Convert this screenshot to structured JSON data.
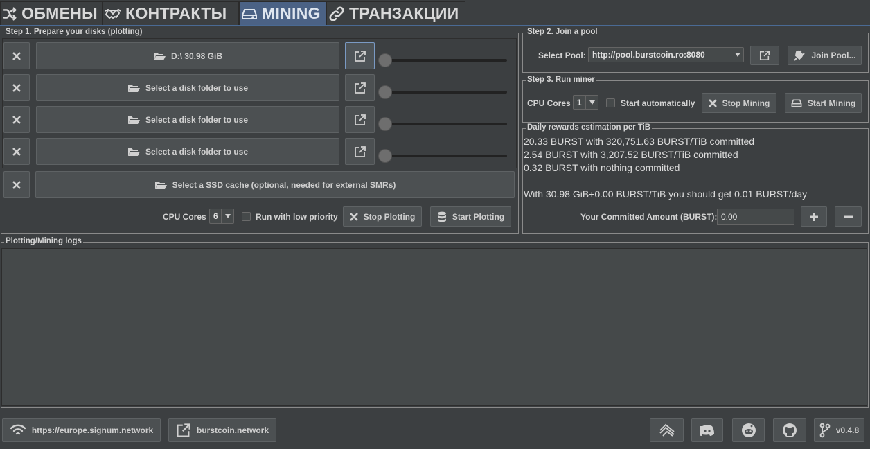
{
  "tabs": [
    {
      "label": "ОБМЕНЫ",
      "icon": "shuffle-icon",
      "active": false
    },
    {
      "label": "КОНТРАКТЫ",
      "icon": "handshake-icon",
      "active": false
    },
    {
      "label": "MINING",
      "icon": "hard-drive-icon",
      "active": true
    },
    {
      "label": "ТРАНЗАКЦИИ",
      "icon": "link-icon",
      "active": false
    }
  ],
  "step1": {
    "title": "Step 1. Prepare your disks (plotting)",
    "disks": [
      {
        "label": "D:\\ 30.98 GiB"
      },
      {
        "label": "Select a disk folder to use"
      },
      {
        "label": "Select a disk folder to use"
      },
      {
        "label": "Select a disk folder to use"
      }
    ],
    "ssd_label": "Select a SSD cache (optional, needed for external SMRs)",
    "cpu_cores_label": "CPU Cores",
    "cpu_cores_value": "6",
    "low_priority_label": "Run with low priority",
    "stop_plotting": "Stop Plotting",
    "start_plotting": "Start Plotting"
  },
  "step2": {
    "title": "Step 2. Join a pool",
    "select_pool_label": "Select Pool:",
    "pool_value": "http://pool.burstcoin.ro:8080",
    "join_pool": "Join Pool..."
  },
  "step3": {
    "title": "Step 3. Run miner",
    "cpu_cores_label": "CPU Cores",
    "cpu_cores_value": "1",
    "start_auto_label": "Start automatically",
    "stop_mining": "Stop Mining",
    "start_mining": "Start Mining"
  },
  "rewards": {
    "title": "Daily rewards estimation per TiB",
    "lines": [
      "20.33 BURST with 320,751.63 BURST/TiB committed",
      "2.54 BURST with 3,207.52 BURST/TiB committed",
      "0.32 BURST with nothing committed",
      "",
      "With 30.98 GiB+0.00 BURST/TiB you should get 0.01 BURST/day"
    ],
    "committed_label": "Your Committed Amount (BURST):",
    "committed_value": "0.00"
  },
  "logs": {
    "title": "Plotting/Mining logs"
  },
  "status": {
    "node": "https://europe.signum.network",
    "link": "burstcoin.network",
    "version": "v0.4.8"
  },
  "colors": {
    "accent": "#4b6285",
    "background": "#3c3f41",
    "button": "#4c5052"
  }
}
